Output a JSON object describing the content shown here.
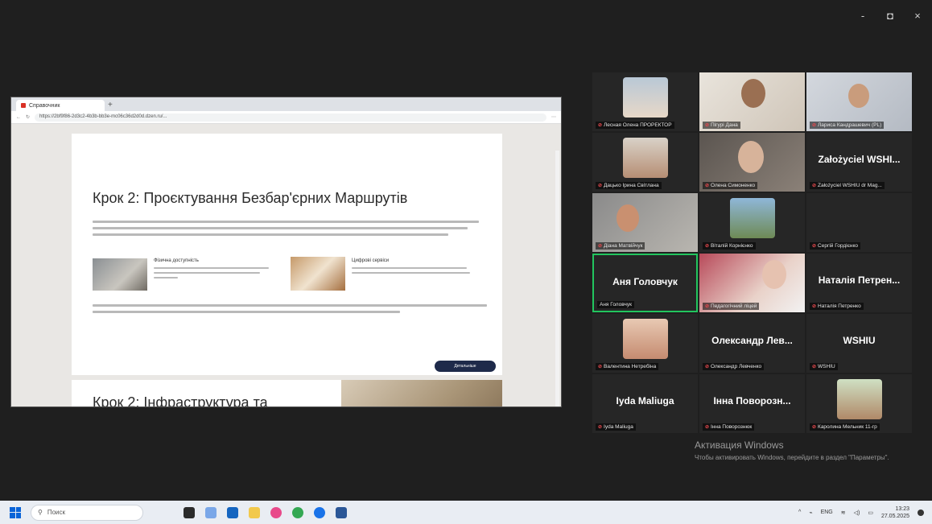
{
  "window_controls": {
    "minimize": "-",
    "maximize": "◘",
    "close": "×"
  },
  "browser": {
    "tab_title": "Справочник",
    "url": "https://2bf9f86-2d3c2-4b3b-bb3e-mc06c36d2d0d.dzen.ru/...",
    "heading1": "Крок 2: Проєктування Безбар'єрних Маршрутів",
    "feature1_title": "Фізична доступність",
    "feature2_title": "Цифрові сервіси",
    "more_button": "Детальніше",
    "heading2": "Крок 2: Інфраструктура та"
  },
  "participants": [
    {
      "label": "Лесная Олена ПРОРЕКТОР",
      "display": "video"
    },
    {
      "label": "Пігурі Дана",
      "display": "video"
    },
    {
      "label": "Лариса Кандрашевич (PL)",
      "display": "video"
    },
    {
      "label": "Дацько Ірина Світлана",
      "display": "video"
    },
    {
      "label": "Олена Симоненко",
      "display": "video"
    },
    {
      "label": "Założyciel WSHIU dr Mag...",
      "display": "name",
      "big_name": "Założyciel WSHI..."
    },
    {
      "label": "Діана Матвійчук",
      "display": "video"
    },
    {
      "label": "Віталій Корнієнко",
      "display": "video"
    },
    {
      "label": "Сергій Гордієнко",
      "display": "blank"
    },
    {
      "label": "Аня Головчук",
      "display": "name",
      "big_name": "Аня Головчук"
    },
    {
      "label": "Педагогічний ліцей",
      "display": "video"
    },
    {
      "label": "Наталія Петренко",
      "display": "name",
      "big_name": "Наталія Петрен..."
    },
    {
      "label": "Валентина Нетребіна",
      "display": "video"
    },
    {
      "label": "Олександр Левченко",
      "display": "name",
      "big_name": "Олександр Лев..."
    },
    {
      "label": "WSHIU",
      "display": "name",
      "big_name": "WSHIU"
    },
    {
      "label": "Iyda Maliuga",
      "display": "name",
      "big_name": "Iyda Maliuga"
    },
    {
      "label": "Інна Поворознюк",
      "display": "name",
      "big_name": "Інна Поворозн..."
    },
    {
      "label": "Каролина Мельник 11-гр",
      "display": "video"
    }
  ],
  "activation": {
    "title": "Активация Windows",
    "subtitle": "Чтобы активировать Windows, перейдите в раздел \"Параметры\"."
  },
  "taskbar": {
    "search_placeholder": "Поиск",
    "lang": "ENG",
    "time": "13:23",
    "date": "27.05.2025"
  },
  "colors": {
    "active_speaker_border": "#22c55e",
    "mic_muted": "#e5484d",
    "taskbar": "#e9edf3"
  }
}
